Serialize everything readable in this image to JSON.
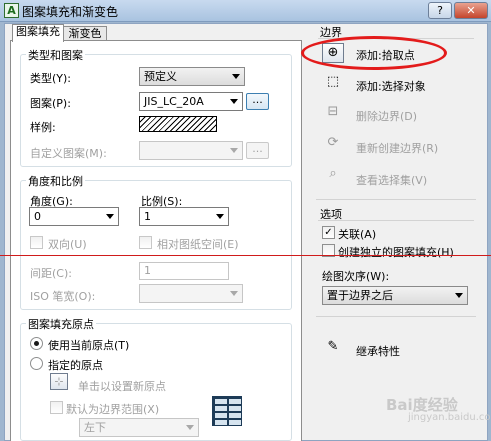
{
  "window": {
    "title": "图案填充和渐变色",
    "help_label": "?",
    "close_label": "✕"
  },
  "tabs": [
    {
      "label": "图案填充",
      "active": true
    },
    {
      "label": "渐变色",
      "active": false
    }
  ],
  "type_pattern": {
    "group_label": "类型和图案",
    "type_label": "类型(Y):",
    "type_value": "预定义",
    "pattern_label": "图案(P):",
    "pattern_value": "JIS_LC_20A",
    "browse_label": "...",
    "swatch_label": "样例:",
    "custom_label": "自定义图案(M):",
    "custom_browse_label": "..."
  },
  "angle_scale": {
    "group_label": "角度和比例",
    "angle_label": "角度(G):",
    "angle_value": "0",
    "scale_label": "比例(S):",
    "scale_value": "1",
    "double_label": "双向(U)",
    "relative_label": "相对图纸空间(E)",
    "spacing_label": "间距(C):",
    "spacing_value": "1",
    "iso_label": "ISO 笔宽(O):"
  },
  "origin": {
    "group_label": "图案填充原点",
    "use_current_label": "使用当前原点(T)",
    "specified_label": "指定的原点",
    "click_set_label": "单击以设置新原点",
    "default_extents_label": "默认为边界范围(X)",
    "position_value": "左下"
  },
  "boundaries": {
    "group_label": "边界",
    "add_pick_label": "添加:拾取点",
    "add_select_label": "添加:选择对象",
    "remove_label": "删除边界(D)",
    "recreate_label": "重新创建边界(R)",
    "view_label": "查看选择集(V)"
  },
  "options": {
    "group_label": "选项",
    "associative_label": "关联(A)",
    "associative_checked": "✓",
    "independent_label": "创建独立的图案填充(H)",
    "draw_order_label": "绘图次序(W):",
    "draw_order_value": "置于边界之后"
  },
  "inherit": {
    "label": "继承特性"
  },
  "watermark": {
    "main": "Bai度经验",
    "sub": "jingyan.baidu.com"
  }
}
